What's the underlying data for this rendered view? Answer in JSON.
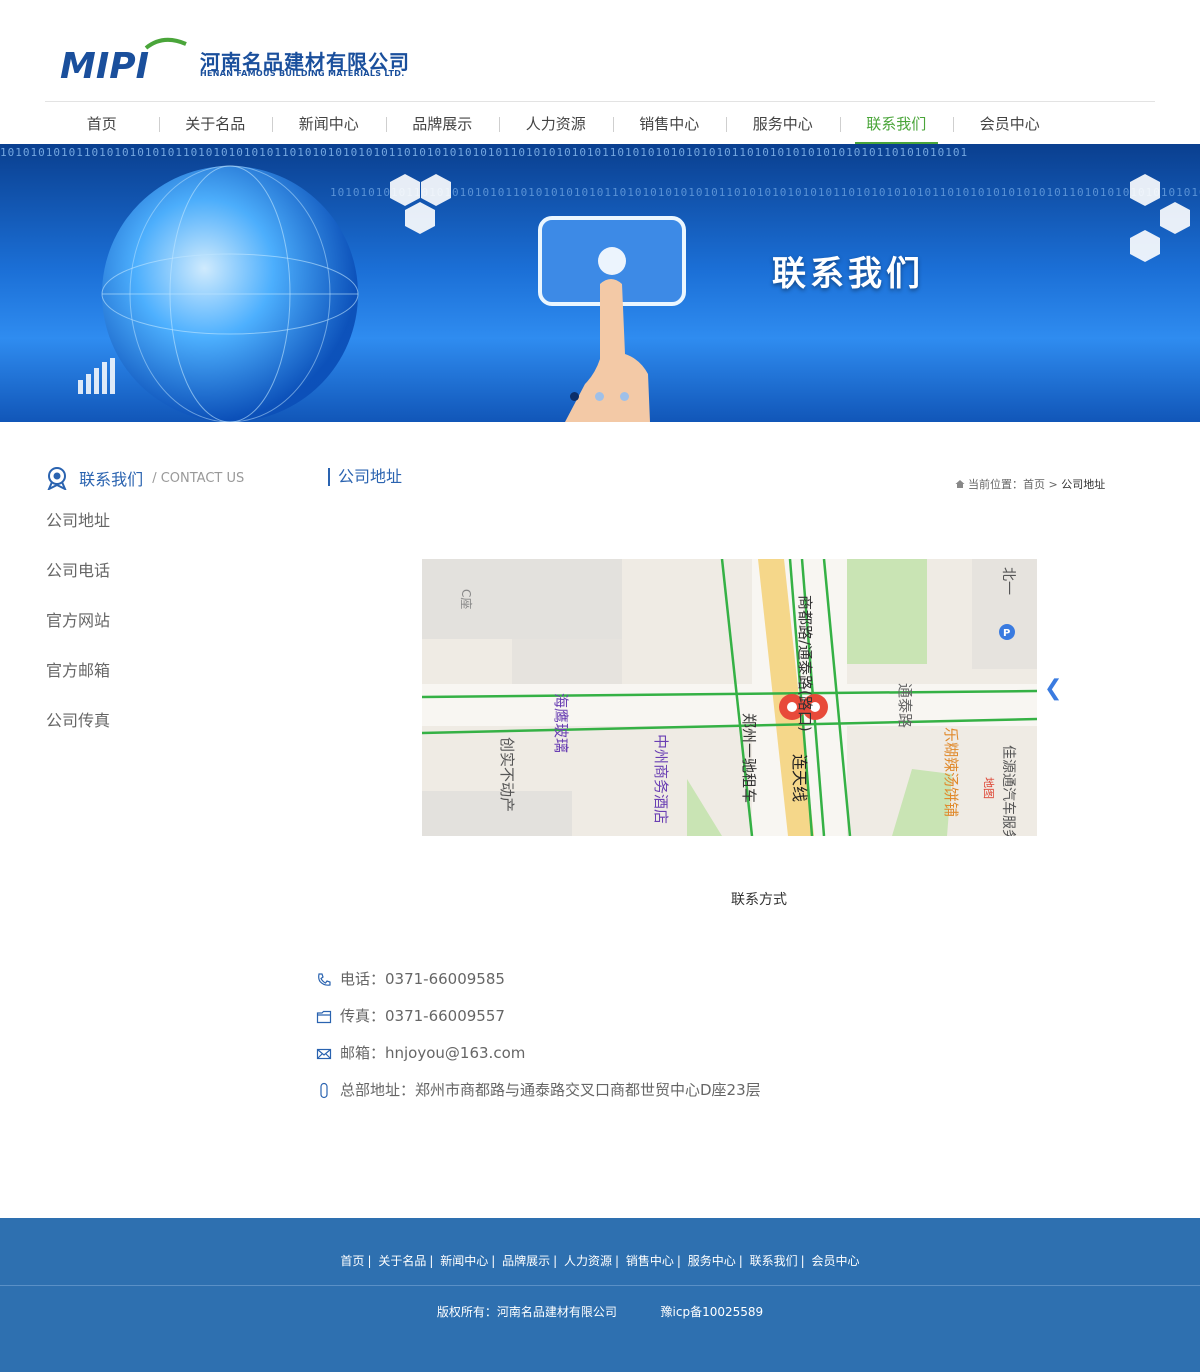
{
  "brand": {
    "logo_text": "MIPI",
    "company_cn": "河南名品建材有限公司",
    "company_en": "HENAN FAMOUS BUILDING MATERIALS LTD."
  },
  "nav": {
    "items": [
      "首页",
      "关于名品",
      "新闻中心",
      "品牌展示",
      "人力资源",
      "销售中心",
      "服务中心",
      "联系我们",
      "会员中心"
    ],
    "active": "联系我们"
  },
  "banner": {
    "title": "联系我们",
    "binary": "1010101010110101010101011010101010101101010101010101101010101010101101010101010110101010101010101101010101010101010110101010101"
  },
  "sidebar": {
    "title": "联系我们",
    "subtitle": "/ CONTACT US",
    "items": [
      "公司地址",
      "公司电话",
      "官方网站",
      "官方邮箱",
      "公司传真"
    ]
  },
  "main": {
    "section_title": "公司地址",
    "breadcrumb": {
      "prefix": "当前位置：",
      "home": "首页",
      "sep": " > ",
      "current": "公司地址"
    },
    "map": {
      "labels": [
        "C座",
        "北一",
        "商都路/通泰路(路口)",
        "通泰路",
        "海鹰玻璃",
        "创实不动产",
        "中州商务酒店",
        "郑州一驰租车",
        "连天线",
        "乐糊辣汤饼铺",
        "佳源通汽车服务公司",
        "地图"
      ]
    },
    "contact_heading": "联系方式",
    "contacts": [
      {
        "icon": "phone-icon",
        "text": "电话：0371-66009585"
      },
      {
        "icon": "fax-icon",
        "text": "传真：0371-66009557"
      },
      {
        "icon": "mail-icon",
        "text": "邮箱：hnjoyou@163.com"
      },
      {
        "icon": "location-icon",
        "text": "总部地址：郑州市商都路与通泰路交叉口商都世贸中心D座23层"
      }
    ]
  },
  "footer": {
    "links": [
      "首页",
      "关于名品",
      "新闻中心",
      "品牌展示",
      "人力资源",
      "销售中心",
      "服务中心",
      "联系我们",
      "会员中心"
    ],
    "copyright": "版权所有：河南名品建材有限公司",
    "icp": "豫icp备10025589"
  },
  "colors": {
    "brand_blue": "#1a4f9c",
    "nav_active": "#4aa53a",
    "footer_bg": "#2e70b0",
    "accent_blue": "#2a63b0"
  }
}
